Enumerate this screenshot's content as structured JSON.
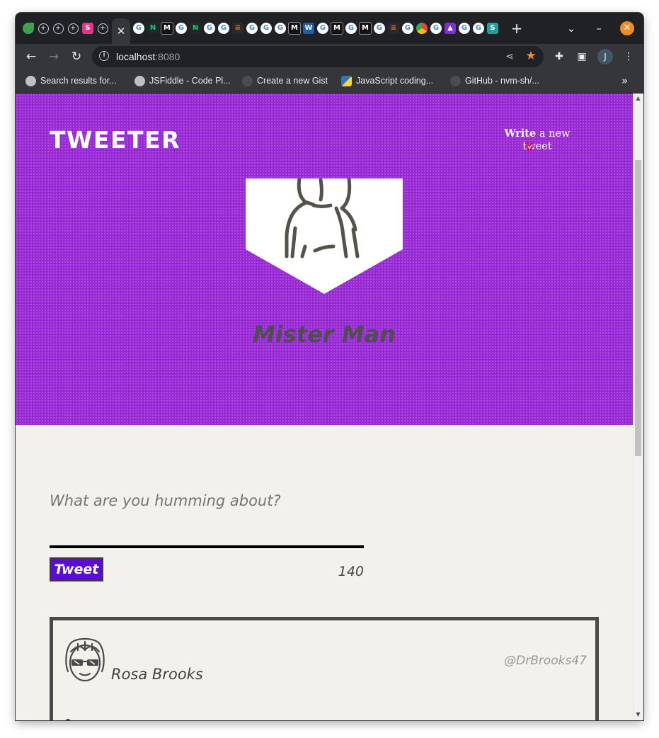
{
  "browser": {
    "address": {
      "host": "localhost",
      "port": ":8080"
    },
    "profile_initial": "J",
    "bookmarks": [
      {
        "label": "Search results for..."
      },
      {
        "label": "JSFiddle - Code Pl..."
      },
      {
        "label": "Create a new Gist"
      },
      {
        "label": "JavaScript coding..."
      },
      {
        "label": "GitHub - nvm-sh/..."
      }
    ],
    "bookmarks_more": "»"
  },
  "app": {
    "logo": "TWEETER",
    "compose_toggle": {
      "bold": "Write",
      "rest": " a new tweet"
    },
    "profile": {
      "name": "Mister Man"
    },
    "composer": {
      "placeholder": "What are you humming about?",
      "submit_label": "Tweet",
      "counter": "140"
    },
    "tweets": [
      {
        "name": "Rosa Brooks",
        "handle": "@DrBrooks47"
      }
    ]
  },
  "colors": {
    "hero": "#9b2ad8",
    "page_bg": "#f3f1ec",
    "tweet_button": "#5a0cd8",
    "chevron": "#e0143c",
    "star": "#f28b24"
  }
}
